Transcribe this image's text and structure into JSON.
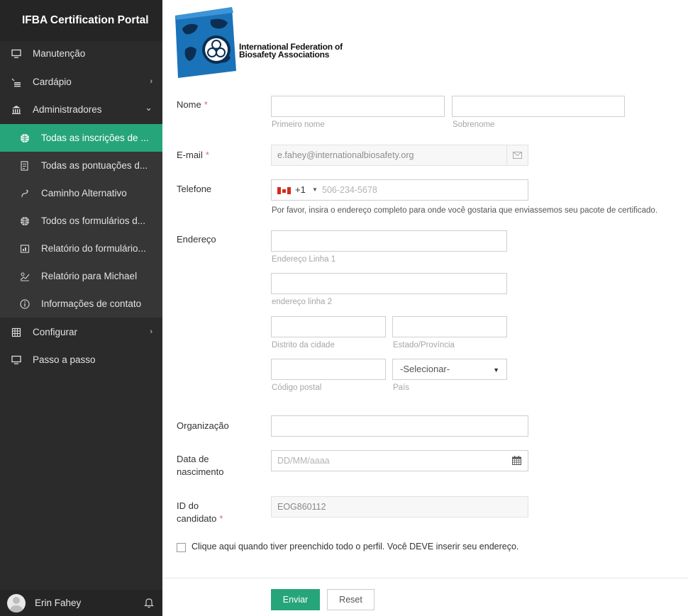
{
  "app": {
    "title": "IFBA Certification Portal"
  },
  "logo": {
    "org_name": "International Federation of Biosafety Associations"
  },
  "sidebar": {
    "items": [
      {
        "label": "Manutenção",
        "icon": "monitor-icon"
      },
      {
        "label": "Cardápio",
        "icon": "menu-list-icon",
        "chevron": "›"
      },
      {
        "label": "Administradores",
        "icon": "bank-icon",
        "chevron": "⌄"
      },
      {
        "label": "Todas as inscrições de ...",
        "icon": "globe-icon",
        "active": true
      },
      {
        "label": "Todas as pontuações d...",
        "icon": "report-icon"
      },
      {
        "label": "Caminho Alternativo",
        "icon": "route-icon"
      },
      {
        "label": "Todos os formulários d...",
        "icon": "globe-icon"
      },
      {
        "label": "Relatório do formulário...",
        "icon": "chart-icon"
      },
      {
        "label": "Relatório para Michael",
        "icon": "user-chart-icon"
      },
      {
        "label": "Informações de contato",
        "icon": "info-icon"
      },
      {
        "label": "Configurar",
        "icon": "grid-icon",
        "chevron": "›"
      },
      {
        "label": "Passo a passo",
        "icon": "monitor-icon"
      }
    ],
    "user": {
      "name": "Erin Fahey"
    }
  },
  "form": {
    "name": {
      "label": "Nome",
      "required": "*",
      "first_caption": "Primeiro nome",
      "last_caption": "Sobrenome",
      "first_value": "",
      "last_value": ""
    },
    "email": {
      "label": "E-mail",
      "required": "*",
      "value": "e.fahey@internationalbiosafety.org"
    },
    "phone": {
      "label": "Telefone",
      "dial_code": "+1",
      "placeholder": "506-234-5678",
      "help": "Por favor, insira o endereço completo para onde você gostaria que enviassemos seu pacote de certificado."
    },
    "address": {
      "label": "Endereço",
      "line1_caption": "Endereço Linha 1",
      "line2_caption": "endereço linha 2",
      "city_caption": "Distrito da cidade",
      "state_caption": "Estado/Província",
      "postal_caption": "Código postal",
      "country_caption": "País",
      "country_value": "-Selecionar-"
    },
    "organization": {
      "label": "Organização",
      "value": ""
    },
    "dob": {
      "label_line1": "Data de",
      "label_line2": "nascimento",
      "placeholder": "DD/MM/aaaa"
    },
    "candidate_id": {
      "label_line1": "ID do",
      "label_line2": "candidato",
      "required": "*",
      "value": "EOG860112"
    },
    "confirm": {
      "label": "Clique aqui quando tiver preenchido todo o perfil. Você DEVE inserir seu endereço.",
      "checked": false
    },
    "buttons": {
      "submit": "Enviar",
      "reset": "Reset"
    }
  },
  "colors": {
    "accent": "#27a57a",
    "sidebar_bg": "#2b2b2b",
    "required": "#e26b6b"
  }
}
